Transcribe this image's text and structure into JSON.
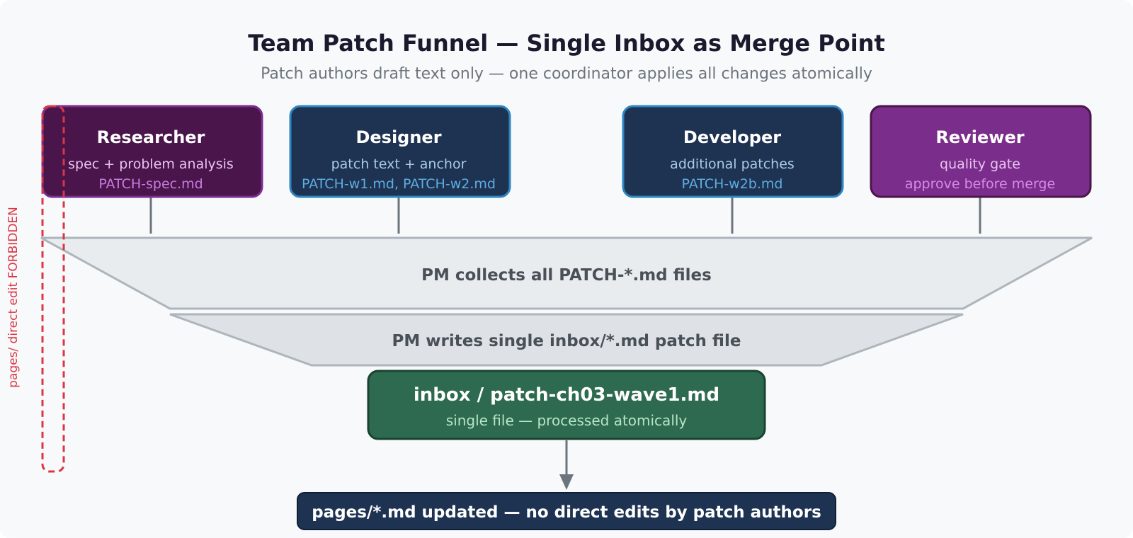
{
  "title": "Team Patch Funnel — Single Inbox as Merge Point",
  "subtitle": "Patch authors draft text only — one coordinator applies all changes atomically",
  "roles": [
    {
      "name": "Researcher",
      "desc": "spec + problem analysis",
      "files": "PATCH-spec.md"
    },
    {
      "name": "Designer",
      "desc": "patch text + anchor",
      "files": "PATCH-w1.md, PATCH-w2.md"
    },
    {
      "name": "Developer",
      "desc": "additional patches",
      "files": "PATCH-w2b.md"
    },
    {
      "name": "Reviewer",
      "desc": "quality gate",
      "files": "approve before merge"
    }
  ],
  "funnel": {
    "stage1": "PM collects all PATCH-*.md files",
    "stage2": "PM writes single inbox/*.md patch file"
  },
  "inbox": {
    "title": "inbox / patch-ch03-wave1.md",
    "subtitle": "single file — processed atomically"
  },
  "output": "pages/*.md updated — no direct edits by patch authors",
  "forbidden_label": "pages/ direct edit FORBIDDEN",
  "colors": {
    "background": "#f8f9fa",
    "title": "#1a1a2e",
    "subtitle": "#6c757d",
    "researcher_fill": "#4a154b",
    "researcher_stroke": "#7b2d8e",
    "navy_fill": "#1e3352",
    "navy_stroke": "#2e86c1",
    "reviewer_fill": "#7b2d8b",
    "reviewer_stroke": "#4a154b",
    "funnel_top": "#e9ecef",
    "funnel_bottom": "#dee2e6",
    "funnel_stroke": "#adb5bd",
    "funnel_text": "#495057",
    "inbox_fill": "#2d6a4f",
    "inbox_stroke": "#1b4332",
    "inbox_sub": "#b7e4c7",
    "output_fill": "#1e3352",
    "forbidden": "#dc3545",
    "connector": "#6c757d"
  }
}
